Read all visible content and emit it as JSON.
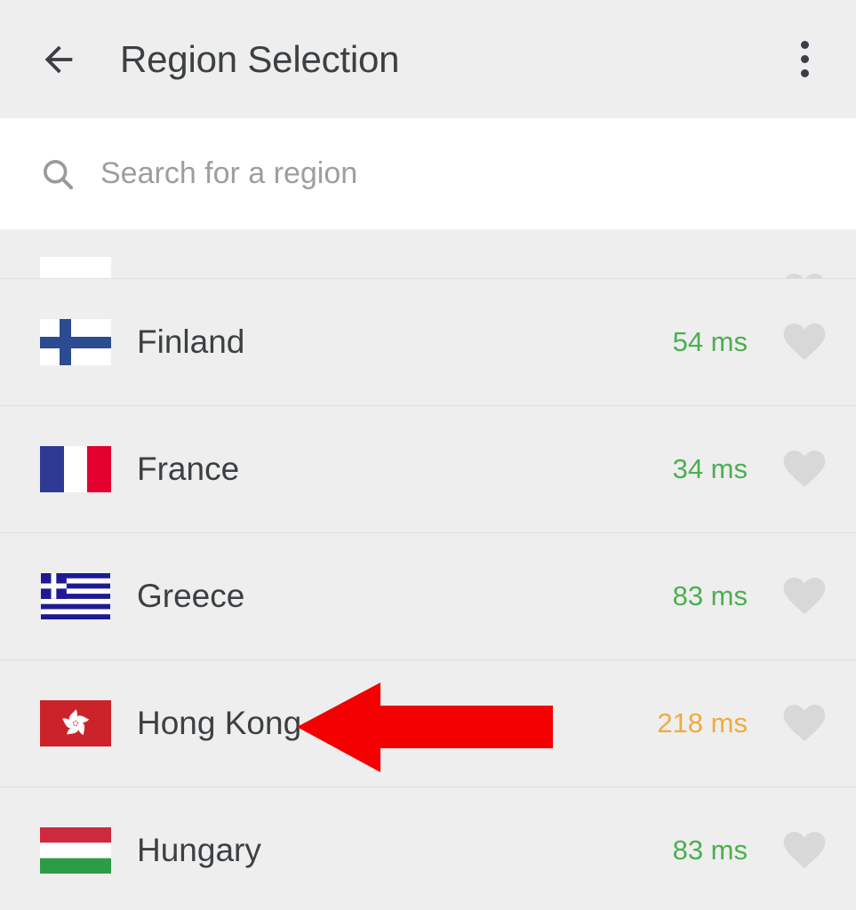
{
  "appbar": {
    "back_icon": "arrow-left-icon",
    "title": "Region Selection",
    "overflow_icon": "more-vertical-icon"
  },
  "search": {
    "icon": "search-icon",
    "placeholder": "Search for a region",
    "value": ""
  },
  "colors": {
    "background": "#eeeeee",
    "search_background": "#ffffff",
    "divider": "#e0e0e0",
    "text_primary": "#3c4043",
    "placeholder": "#9e9e9e",
    "latency_good": "#4caf50",
    "latency_medium": "#f0ab3c",
    "heart_inactive": "#d8d8d8",
    "annotation_arrow": "#f40000"
  },
  "list": {
    "rows": [
      {
        "name": "",
        "latency": "",
        "latency_state": "",
        "flag": "partial-flag",
        "favorite": false,
        "partial": true
      },
      {
        "name": "Finland",
        "latency": "54 ms",
        "latency_state": "good",
        "flag": "flag-finland",
        "favorite": false,
        "partial": false
      },
      {
        "name": "France",
        "latency": "34 ms",
        "latency_state": "good",
        "flag": "flag-france",
        "favorite": false,
        "partial": false
      },
      {
        "name": "Greece",
        "latency": "83 ms",
        "latency_state": "good",
        "flag": "flag-greece",
        "favorite": false,
        "partial": false
      },
      {
        "name": "Hong Kong",
        "latency": "218 ms",
        "latency_state": "medium",
        "flag": "flag-hong-kong",
        "favorite": false,
        "partial": false
      },
      {
        "name": "Hungary",
        "latency": "83 ms",
        "latency_state": "good",
        "flag": "flag-hungary",
        "favorite": false,
        "partial": false
      }
    ]
  },
  "annotation": {
    "type": "arrow-left-annotation",
    "points_at": "Hong Kong",
    "color": "#f40000"
  }
}
